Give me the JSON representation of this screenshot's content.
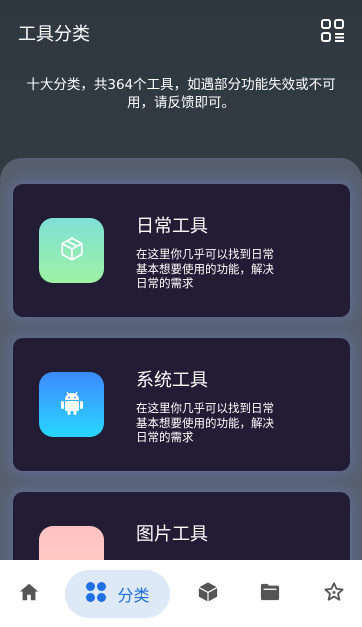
{
  "header": {
    "title": "工具分类",
    "menu_icon": "grid-icon"
  },
  "subtitle": "十大分类，共364个工具，如遇部分功能失效或不可用，请反馈即可。",
  "categories": [
    {
      "title": "日常工具",
      "description": "在这里你几乎可以找到日常基本想要使用的功能，解决日常的需求",
      "icon": "cube-icon",
      "tile_gradient": [
        "#7fe0d6",
        "#9ef2a3"
      ]
    },
    {
      "title": "系统工具",
      "description": "在这里你几乎可以找到日常基本想要使用的功能，解决日常的需求",
      "icon": "android-icon",
      "tile_gradient": [
        "#3d8bff",
        "#28d6ff"
      ]
    },
    {
      "title": "图片工具",
      "description": "",
      "icon": "image-icon",
      "tile_gradient": [
        "#ffc2c2",
        "#ffd0c4"
      ]
    }
  ],
  "bottom_nav": {
    "items": [
      {
        "icon": "home-icon"
      },
      {
        "icon": "category-icon",
        "label": "分类",
        "active": true
      },
      {
        "icon": "box-icon"
      },
      {
        "icon": "folder-icon"
      },
      {
        "icon": "star-icon"
      }
    ]
  },
  "colors": {
    "accent": "#1f6ee6",
    "card_bg": "#221c35",
    "panel_bg": "#56606d"
  }
}
